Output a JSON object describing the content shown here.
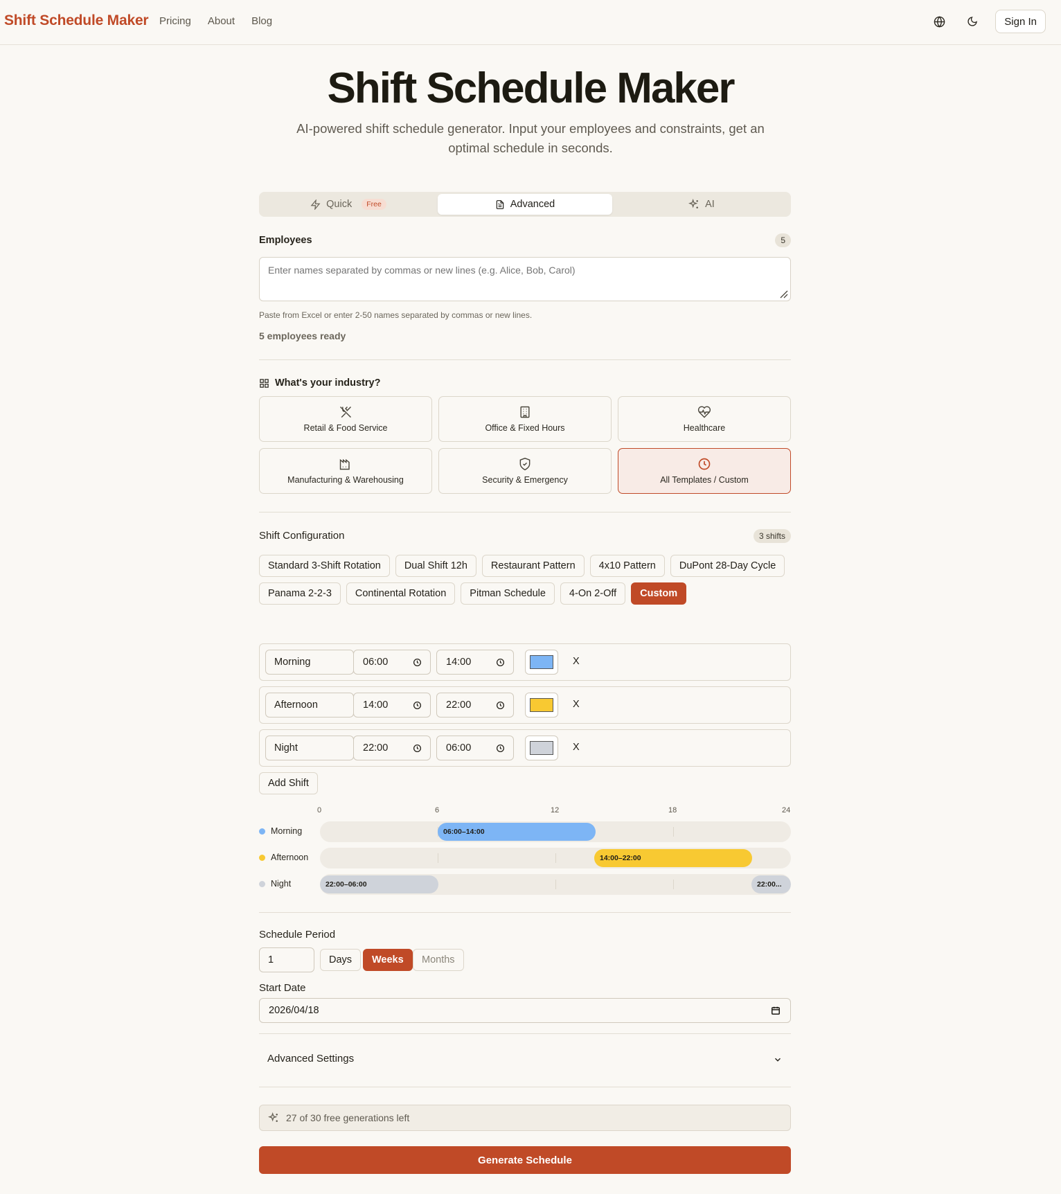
{
  "nav": {
    "brand": "Shift Schedule Maker",
    "links": [
      "Pricing",
      "About",
      "Blog"
    ],
    "icons": [
      "globe-icon",
      "moon-icon"
    ],
    "sign_in": "Sign In"
  },
  "hero": {
    "title": "Shift Schedule Maker",
    "subtitle": "AI-powered shift schedule generator. Input your employees and constraints, get an optimal schedule in seconds."
  },
  "tabs": {
    "quick": "Quick",
    "quick_badge": "Free",
    "advanced": "Advanced",
    "ai": "AI",
    "active": "Advanced"
  },
  "employees": {
    "label": "Employees",
    "count": "5",
    "placeholder": "Enter names separated by commas or new lines (e.g. Alice, Bob, Carol)",
    "hint": "Paste from Excel or enter 2-50 names separated by commas or new lines.",
    "status": "5 employees ready"
  },
  "industry": {
    "label": "What's your industry?",
    "options": [
      {
        "label": "Retail & Food Service",
        "icon": "utensils-icon"
      },
      {
        "label": "Office & Fixed Hours",
        "icon": "building-icon"
      },
      {
        "label": "Healthcare",
        "icon": "heart-pulse-icon"
      },
      {
        "label": "Manufacturing & Warehousing",
        "icon": "factory-icon"
      },
      {
        "label": "Security & Emergency",
        "icon": "shield-icon"
      },
      {
        "label": "All Templates / Custom",
        "icon": "clock-icon"
      }
    ],
    "selected": "All Templates / Custom"
  },
  "shift_config": {
    "label": "Shift Configuration",
    "count": "3 shifts",
    "presets": [
      "Standard 3-Shift Rotation",
      "Dual Shift 12h",
      "Restaurant Pattern",
      "4x10 Pattern",
      "DuPont 28-Day Cycle",
      "Panama 2-2-3",
      "Continental Rotation",
      "Pitman Schedule",
      "4-On 2-Off",
      "Custom"
    ],
    "selected_preset": "Custom",
    "shifts": [
      {
        "name": "Morning",
        "start": "06:00",
        "end": "14:00",
        "color": "#7db5f5",
        "remove": "X"
      },
      {
        "name": "Afternoon",
        "start": "14:00",
        "end": "22:00",
        "color": "#f8c932",
        "remove": "X"
      },
      {
        "name": "Night",
        "start": "22:00",
        "end": "06:00",
        "color": "#cfd3da",
        "remove": "X"
      }
    ],
    "add_label": "Add Shift"
  },
  "timeline": {
    "ticks": [
      "0",
      "6",
      "12",
      "18",
      "24"
    ],
    "rows": [
      {
        "name": "Morning",
        "label": "06:00–14:00",
        "color": "#7db5f5"
      },
      {
        "name": "Afternoon",
        "label": "14:00–22:00",
        "color": "#f8c932"
      },
      {
        "name": "Night",
        "label": "22:00–06:00",
        "label_tail": "22:00...",
        "color": "#cfd3da"
      }
    ]
  },
  "schedule_period": {
    "label": "Schedule Period",
    "value": "1",
    "units": [
      "Days",
      "Weeks",
      "Months"
    ],
    "selected_unit": "Weeks"
  },
  "start_date": {
    "label": "Start Date",
    "value": "2026/04/18"
  },
  "advanced_settings": {
    "label": "Advanced Settings"
  },
  "generations": {
    "text": "27 of 30 free generations left"
  },
  "generate_label": "Generate Schedule"
}
